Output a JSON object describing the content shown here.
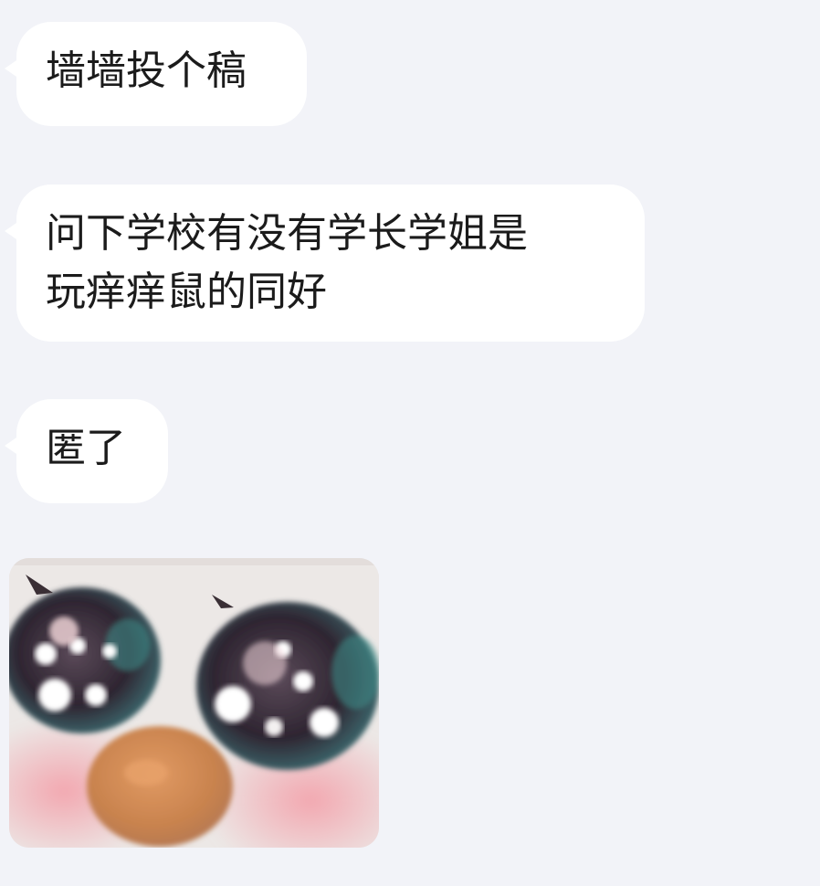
{
  "messages": [
    {
      "text": "墙墙投个稿"
    },
    {
      "text": "问下学校有没有学长学姐是\n玩痒痒鼠的同好"
    },
    {
      "text": "匿了"
    }
  ],
  "sticker": {
    "icon": "crying-eyes-sticker",
    "colors": {
      "blush": "#f0b3b8",
      "nose": "#d58a52",
      "iris": "#3b2f3d",
      "iris_ring": "#4b8f8c"
    }
  }
}
